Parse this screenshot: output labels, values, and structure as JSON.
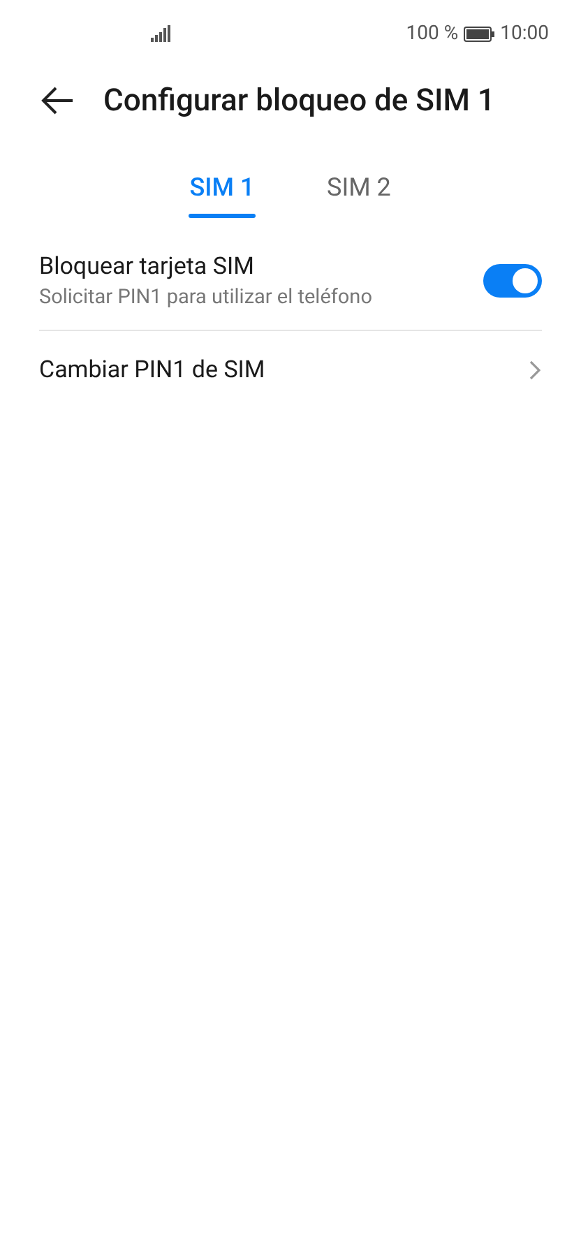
{
  "status_bar": {
    "battery": "100 %",
    "time": "10:00"
  },
  "header": {
    "title": "Configurar bloqueo de SIM 1"
  },
  "tabs": [
    {
      "label": "SIM 1",
      "selected": true
    },
    {
      "label": "SIM 2",
      "selected": false
    }
  ],
  "rows": [
    {
      "kind": "toggle",
      "title": "Bloquear tarjeta SIM",
      "subtitle": "Solicitar PIN1 para utilizar el teléfono",
      "on": true
    },
    {
      "kind": "link",
      "title": "Cambiar PIN1 de SIM"
    }
  ]
}
